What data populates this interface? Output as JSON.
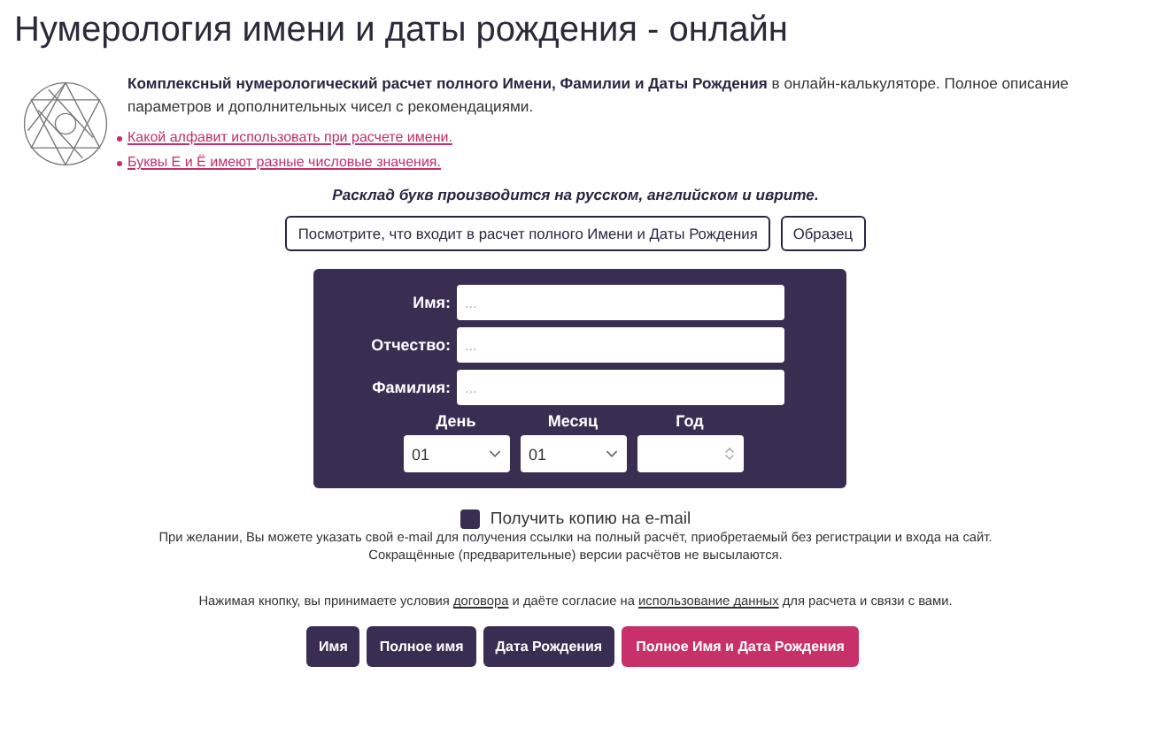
{
  "title": "Нумерология имени и даты рождения - онлайн",
  "intro": {
    "bold": "Комплексный нумерологический расчет полного Имени, Фамилии и Даты Рождения",
    "rest": " в онлайн-калькуляторе. Полное описание параметров и дополнительных чисел с рекомендациями."
  },
  "links": [
    "Какой алфавит использовать при расчете имени.",
    "Буквы Е и Ё имеют разные числовые значения."
  ],
  "note": "Расклад букв производится на русском, английском и иврите.",
  "info_buttons": [
    "Посмотрите, что входит в расчет полного Имени и Даты Рождения",
    "Образец"
  ],
  "form": {
    "fields": [
      {
        "label": "Имя:",
        "placeholder": "..."
      },
      {
        "label": "Отчество:",
        "placeholder": "..."
      },
      {
        "label": "Фамилия:",
        "placeholder": "..."
      }
    ],
    "date": [
      {
        "label": "День",
        "kind": "select",
        "value": "01"
      },
      {
        "label": "Месяц",
        "kind": "select",
        "value": "01"
      },
      {
        "label": "Год",
        "kind": "number"
      }
    ]
  },
  "email_copy": {
    "label": "Получить копию на e-mail",
    "checked": false
  },
  "email_info": [
    "При желании, Вы можете указать свой e-mail для получения ссылки на полный расчёт, приобретаемый без регистрации и входа на сайт.",
    "Сокращённые (предварительные) версии расчётов не высылаются."
  ],
  "agreement": {
    "before": "Нажимая кнопку, вы принимаете условия ",
    "link1": "договора",
    "middle": " и даёте согласие на ",
    "link2": "использование данных",
    "after": " для расчета и связи с вами."
  },
  "actions": [
    {
      "label": "Имя",
      "kind": "primary"
    },
    {
      "label": "Полное имя",
      "kind": "primary"
    },
    {
      "label": "Дата Рождения",
      "kind": "primary"
    },
    {
      "label": "Полное Имя и Дата Рождения",
      "kind": "accent"
    }
  ]
}
